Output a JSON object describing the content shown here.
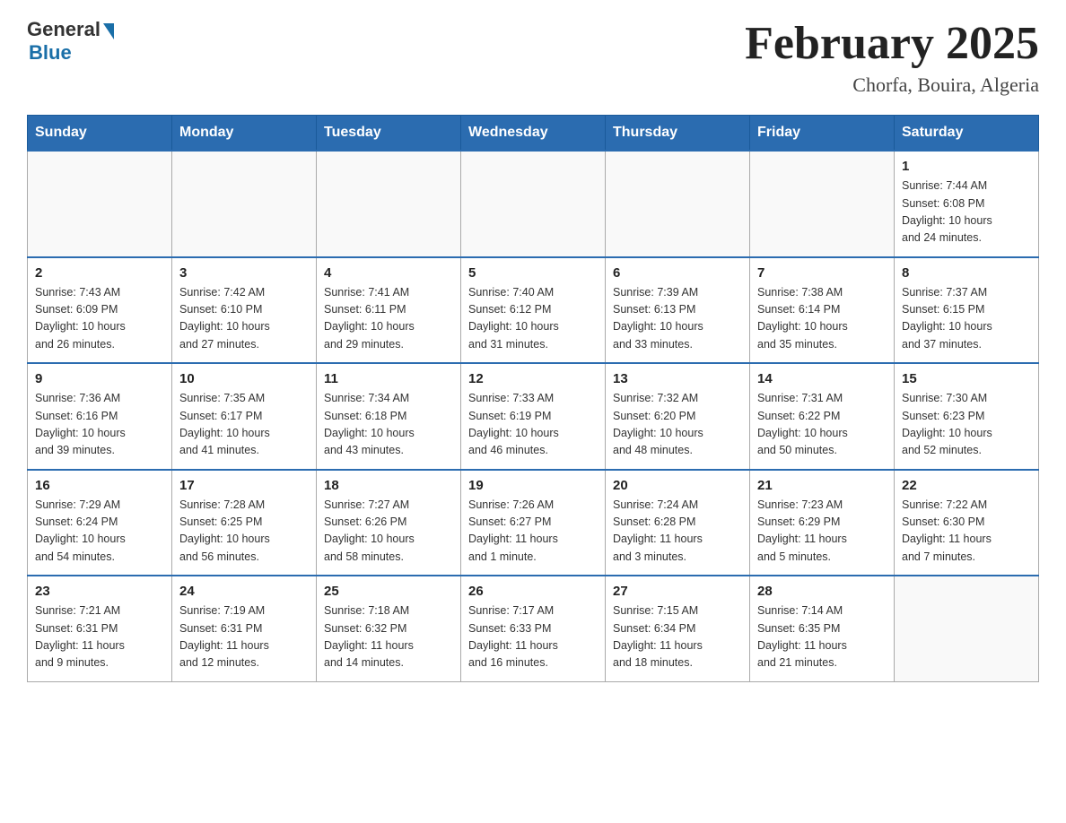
{
  "logo": {
    "general": "General",
    "blue": "Blue"
  },
  "title": {
    "month": "February 2025",
    "location": "Chorfa, Bouira, Algeria"
  },
  "weekdays": [
    "Sunday",
    "Monday",
    "Tuesday",
    "Wednesday",
    "Thursday",
    "Friday",
    "Saturday"
  ],
  "weeks": [
    [
      {
        "day": "",
        "info": ""
      },
      {
        "day": "",
        "info": ""
      },
      {
        "day": "",
        "info": ""
      },
      {
        "day": "",
        "info": ""
      },
      {
        "day": "",
        "info": ""
      },
      {
        "day": "",
        "info": ""
      },
      {
        "day": "1",
        "info": "Sunrise: 7:44 AM\nSunset: 6:08 PM\nDaylight: 10 hours\nand 24 minutes."
      }
    ],
    [
      {
        "day": "2",
        "info": "Sunrise: 7:43 AM\nSunset: 6:09 PM\nDaylight: 10 hours\nand 26 minutes."
      },
      {
        "day": "3",
        "info": "Sunrise: 7:42 AM\nSunset: 6:10 PM\nDaylight: 10 hours\nand 27 minutes."
      },
      {
        "day": "4",
        "info": "Sunrise: 7:41 AM\nSunset: 6:11 PM\nDaylight: 10 hours\nand 29 minutes."
      },
      {
        "day": "5",
        "info": "Sunrise: 7:40 AM\nSunset: 6:12 PM\nDaylight: 10 hours\nand 31 minutes."
      },
      {
        "day": "6",
        "info": "Sunrise: 7:39 AM\nSunset: 6:13 PM\nDaylight: 10 hours\nand 33 minutes."
      },
      {
        "day": "7",
        "info": "Sunrise: 7:38 AM\nSunset: 6:14 PM\nDaylight: 10 hours\nand 35 minutes."
      },
      {
        "day": "8",
        "info": "Sunrise: 7:37 AM\nSunset: 6:15 PM\nDaylight: 10 hours\nand 37 minutes."
      }
    ],
    [
      {
        "day": "9",
        "info": "Sunrise: 7:36 AM\nSunset: 6:16 PM\nDaylight: 10 hours\nand 39 minutes."
      },
      {
        "day": "10",
        "info": "Sunrise: 7:35 AM\nSunset: 6:17 PM\nDaylight: 10 hours\nand 41 minutes."
      },
      {
        "day": "11",
        "info": "Sunrise: 7:34 AM\nSunset: 6:18 PM\nDaylight: 10 hours\nand 43 minutes."
      },
      {
        "day": "12",
        "info": "Sunrise: 7:33 AM\nSunset: 6:19 PM\nDaylight: 10 hours\nand 46 minutes."
      },
      {
        "day": "13",
        "info": "Sunrise: 7:32 AM\nSunset: 6:20 PM\nDaylight: 10 hours\nand 48 minutes."
      },
      {
        "day": "14",
        "info": "Sunrise: 7:31 AM\nSunset: 6:22 PM\nDaylight: 10 hours\nand 50 minutes."
      },
      {
        "day": "15",
        "info": "Sunrise: 7:30 AM\nSunset: 6:23 PM\nDaylight: 10 hours\nand 52 minutes."
      }
    ],
    [
      {
        "day": "16",
        "info": "Sunrise: 7:29 AM\nSunset: 6:24 PM\nDaylight: 10 hours\nand 54 minutes."
      },
      {
        "day": "17",
        "info": "Sunrise: 7:28 AM\nSunset: 6:25 PM\nDaylight: 10 hours\nand 56 minutes."
      },
      {
        "day": "18",
        "info": "Sunrise: 7:27 AM\nSunset: 6:26 PM\nDaylight: 10 hours\nand 58 minutes."
      },
      {
        "day": "19",
        "info": "Sunrise: 7:26 AM\nSunset: 6:27 PM\nDaylight: 11 hours\nand 1 minute."
      },
      {
        "day": "20",
        "info": "Sunrise: 7:24 AM\nSunset: 6:28 PM\nDaylight: 11 hours\nand 3 minutes."
      },
      {
        "day": "21",
        "info": "Sunrise: 7:23 AM\nSunset: 6:29 PM\nDaylight: 11 hours\nand 5 minutes."
      },
      {
        "day": "22",
        "info": "Sunrise: 7:22 AM\nSunset: 6:30 PM\nDaylight: 11 hours\nand 7 minutes."
      }
    ],
    [
      {
        "day": "23",
        "info": "Sunrise: 7:21 AM\nSunset: 6:31 PM\nDaylight: 11 hours\nand 9 minutes."
      },
      {
        "day": "24",
        "info": "Sunrise: 7:19 AM\nSunset: 6:31 PM\nDaylight: 11 hours\nand 12 minutes."
      },
      {
        "day": "25",
        "info": "Sunrise: 7:18 AM\nSunset: 6:32 PM\nDaylight: 11 hours\nand 14 minutes."
      },
      {
        "day": "26",
        "info": "Sunrise: 7:17 AM\nSunset: 6:33 PM\nDaylight: 11 hours\nand 16 minutes."
      },
      {
        "day": "27",
        "info": "Sunrise: 7:15 AM\nSunset: 6:34 PM\nDaylight: 11 hours\nand 18 minutes."
      },
      {
        "day": "28",
        "info": "Sunrise: 7:14 AM\nSunset: 6:35 PM\nDaylight: 11 hours\nand 21 minutes."
      },
      {
        "day": "",
        "info": ""
      }
    ]
  ]
}
